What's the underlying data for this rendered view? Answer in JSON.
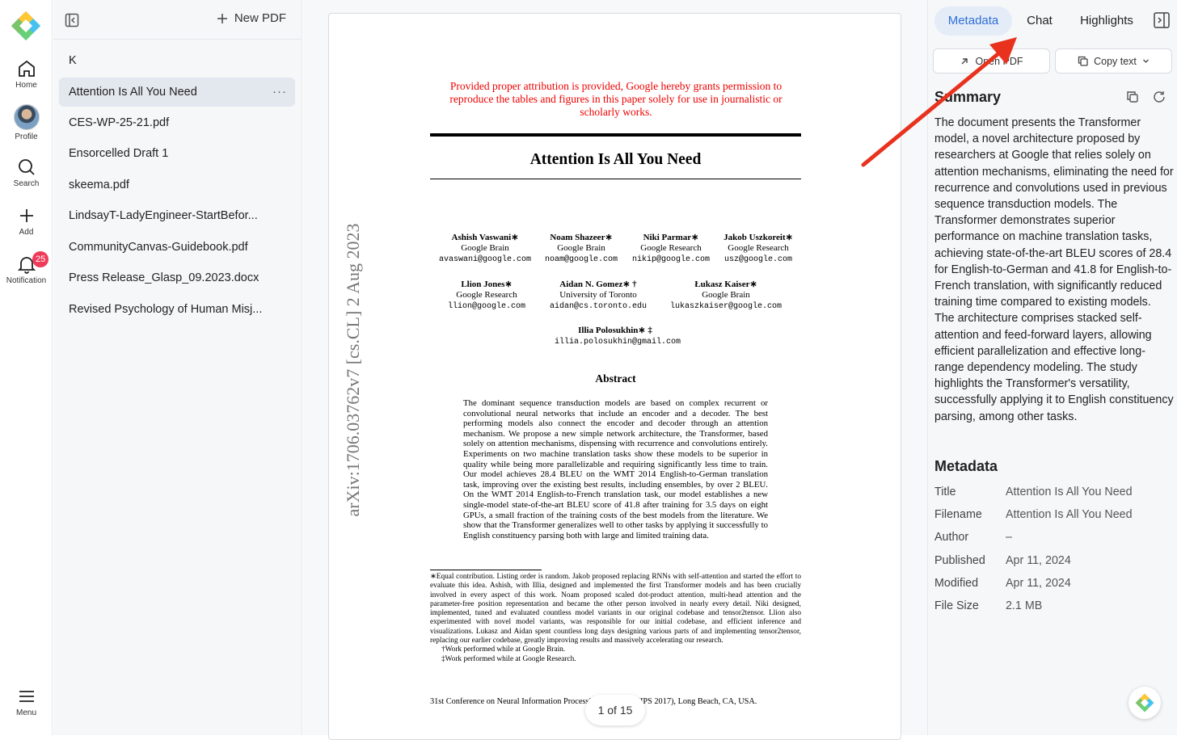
{
  "rail": {
    "home": "Home",
    "profile": "Profile",
    "search": "Search",
    "add": "Add",
    "notification": "Notification",
    "notification_count": "25",
    "menu": "Menu"
  },
  "sidebar": {
    "new_pdf": "New PDF",
    "files": [
      "K",
      "Attention Is All You Need",
      "CES-WP-25-21.pdf",
      "Ensorcelled Draft 1",
      "skeema.pdf",
      "LindsayT-LadyEngineer-StartBefor...",
      "CommunityCanvas-Guidebook.pdf",
      "Press Release_Glasp_09.2023.docx",
      "Revised Psychology of Human Misj..."
    ],
    "more": "···"
  },
  "document": {
    "permission": "Provided proper attribution is provided, Google hereby grants permission to reproduce the tables and figures in this paper solely for use in journalistic or scholarly works.",
    "title": "Attention Is All You Need",
    "authors": [
      {
        "name": "Ashish Vaswani∗",
        "org": "Google Brain",
        "email": "avaswani@google.com"
      },
      {
        "name": "Noam Shazeer∗",
        "org": "Google Brain",
        "email": "noam@google.com"
      },
      {
        "name": "Niki Parmar∗",
        "org": "Google Research",
        "email": "nikip@google.com"
      },
      {
        "name": "Jakob Uszkoreit∗",
        "org": "Google Research",
        "email": "usz@google.com"
      },
      {
        "name": "Llion Jones∗",
        "org": "Google Research",
        "email": "llion@google.com"
      },
      {
        "name": "Aidan N. Gomez∗ †",
        "org": "University of Toronto",
        "email": "aidan@cs.toronto.edu"
      },
      {
        "name": "Łukasz Kaiser∗",
        "org": "Google Brain",
        "email": "lukaszkaiser@google.com"
      },
      {
        "name": "Illia Polosukhin∗ ‡",
        "org": "",
        "email": "illia.polosukhin@gmail.com"
      }
    ],
    "arxiv": "arXiv:1706.03762v7  [cs.CL]  2 Aug 2023",
    "abstract_heading": "Abstract",
    "abstract": "The dominant sequence transduction models are based on complex recurrent or convolutional neural networks that include an encoder and a decoder. The best performing models also connect the encoder and decoder through an attention mechanism. We propose a new simple network architecture, the Transformer, based solely on attention mechanisms, dispensing with recurrence and convolutions entirely. Experiments on two machine translation tasks show these models to be superior in quality while being more parallelizable and requiring significantly less time to train. Our model achieves 28.4 BLEU on the WMT 2014 English-to-German translation task, improving over the existing best results, including ensembles, by over 2 BLEU. On the WMT 2014 English-to-French translation task, our model establishes a new single-model state-of-the-art BLEU score of 41.8 after training for 3.5 days on eight GPUs, a small fraction of the training costs of the best models from the literature. We show that the Transformer generalizes well to other tasks by applying it successfully to English constituency parsing both with large and limited training data.",
    "footnote1": "∗Equal contribution. Listing order is random. Jakob proposed replacing RNNs with self-attention and started the effort to evaluate this idea. Ashish, with Illia, designed and implemented the first Transformer models and has been crucially involved in every aspect of this work. Noam proposed scaled dot-product attention, multi-head attention and the parameter-free position representation and became the other person involved in nearly every detail. Niki designed, implemented, tuned and evaluated countless model variants in our original codebase and tensor2tensor. Llion also experimented with novel model variants, was responsible for our initial codebase, and efficient inference and visualizations. Lukasz and Aidan spent countless long days designing various parts of and implementing tensor2tensor, replacing our earlier codebase, greatly improving results and massively accelerating our research.",
    "footnote2": "†Work performed while at Google Brain.",
    "footnote3": "‡Work performed while at Google Research.",
    "conference": "31st Conference on Neural Information Processing Systems (NIPS 2017), Long Beach, CA, USA.",
    "pager": "1 of 15"
  },
  "panel": {
    "tabs": [
      "Metadata",
      "Chat",
      "Highlights"
    ],
    "open_pdf": "Open PDF",
    "copy_text": "Copy text",
    "summary_heading": "Summary",
    "summary": "The document presents the Transformer model, a novel architecture proposed by researchers at Google that relies solely on attention mechanisms, eliminating the need for recurrence and convolutions used in previous sequence transduction models. The Transformer demonstrates superior performance on machine translation tasks, achieving state-of-the-art BLEU scores of 28.4 for English-to-German and 41.8 for English-to-French translation, with significantly reduced training time compared to existing models. The architecture comprises stacked self-attention and feed-forward layers, allowing efficient parallelization and effective long-range dependency modeling. The study highlights the Transformer's versatility, successfully applying it to English constituency parsing, among other tasks.",
    "metadata_heading": "Metadata",
    "metadata": [
      {
        "key": "Title",
        "value": "Attention Is All You Need"
      },
      {
        "key": "Filename",
        "value": "Attention Is All You Need"
      },
      {
        "key": "Author",
        "value": "–"
      },
      {
        "key": "Published",
        "value": "Apr 11, 2024"
      },
      {
        "key": "Modified",
        "value": "Apr 11, 2024"
      },
      {
        "key": "File Size",
        "value": "2.1 MB"
      }
    ]
  },
  "colors": {
    "accent": "#2f6fd6",
    "arrow": "#e8321e",
    "badge": "#ef3b5a",
    "permission": "#ee0000"
  }
}
